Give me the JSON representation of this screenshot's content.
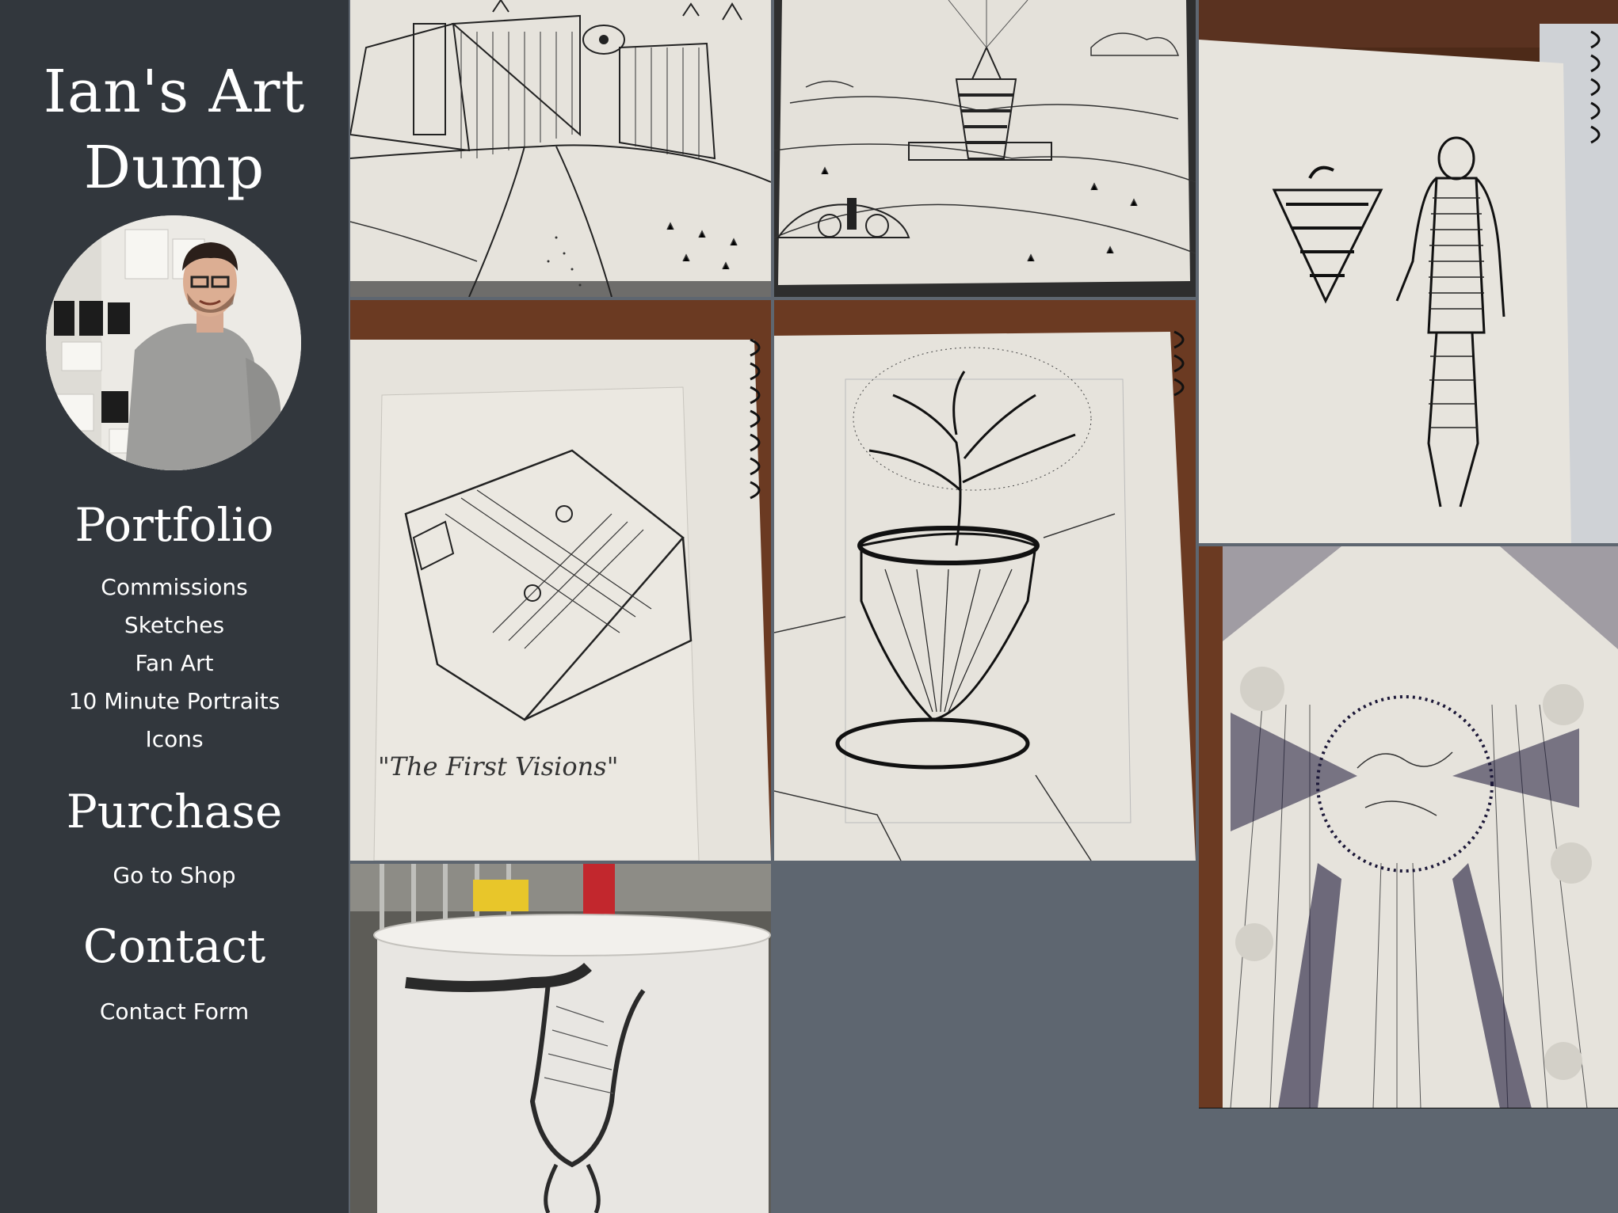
{
  "sidebar": {
    "title_line1": "Ian's Art",
    "title_line2": "Dump",
    "sections": {
      "portfolio": {
        "heading": "Portfolio",
        "links": [
          "Commissions",
          "Sketches",
          "Fan Art",
          "10 Minute Portraits",
          "Icons"
        ]
      },
      "purchase": {
        "heading": "Purchase",
        "links": [
          "Go to Shop"
        ]
      },
      "contact": {
        "heading": "Contact",
        "links": [
          "Contact Form"
        ]
      }
    }
  },
  "gallery": {
    "captions": {
      "book_drawing": "\"The First Visions\""
    }
  },
  "colors": {
    "sidebar_bg": "#32373d",
    "page_bg": "#5e6670",
    "paper": "#e8e5de",
    "ink": "#1a1a1a",
    "wood": "#6b3a22"
  }
}
